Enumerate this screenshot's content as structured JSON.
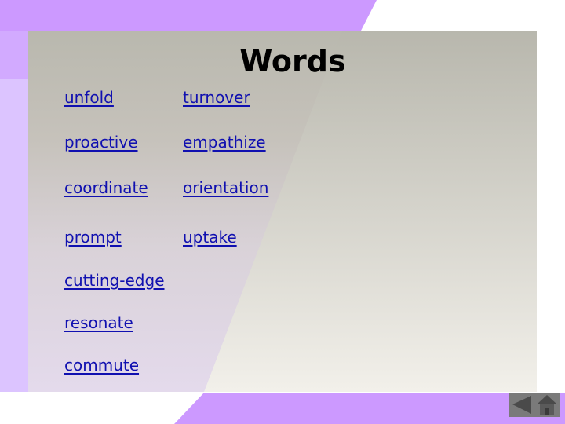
{
  "slide": {
    "title": "Words",
    "columns": [
      [
        "unfold",
        "proactive",
        "coordinate",
        "prompt",
        "cutting-edge",
        "resonate",
        "commute"
      ],
      [
        "turnover",
        "empathize",
        "orientation",
        "uptake"
      ]
    ]
  },
  "colors": {
    "accent_purple": "#cc99ff",
    "link": "#1010b0",
    "nav_bg": "#7a7a7a",
    "nav_icon": "#4a4a4a"
  },
  "nav": {
    "back_icon": "back-arrow-icon",
    "home_icon": "home-icon"
  }
}
